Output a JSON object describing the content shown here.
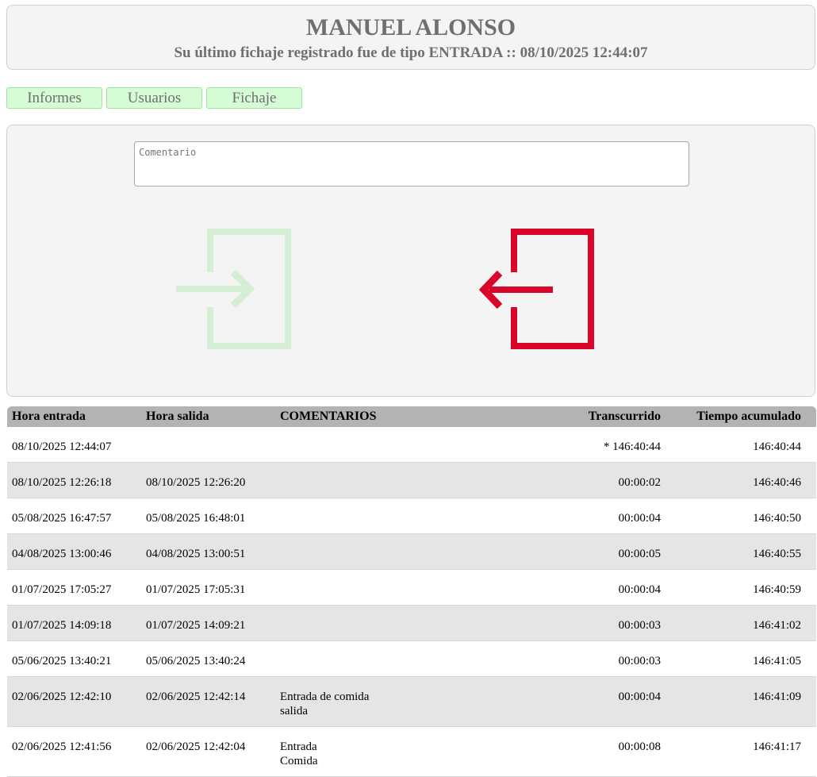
{
  "header": {
    "name": "MANUEL ALONSO",
    "last_entry": "Su último fichaje registrado fue de tipo ENTRADA :: 08/10/2025 12:44:07"
  },
  "nav": {
    "informes": "Informes",
    "usuarios": "Usuarios",
    "fichaje": "Fichaje"
  },
  "panel": {
    "comment_placeholder": "Comentario",
    "comment_value": "",
    "icon_in": "login-arrow-icon",
    "icon_out": "logout-arrow-icon",
    "colors": {
      "entry_disabled": "#d4efd4",
      "exit_active": "#d9062a"
    }
  },
  "table": {
    "headers": {
      "entrada": "Hora entrada",
      "salida": "Hora salida",
      "comentarios": "COMENTARIOS",
      "transcurrido": "Transcurrido",
      "acumulado": "Tiempo acumulado"
    },
    "rows": [
      {
        "entrada": "08/10/2025 12:44:07",
        "salida": "",
        "c1": "",
        "c2": "",
        "transcurrido": "* 146:40:44",
        "acumulado": "146:40:44"
      },
      {
        "entrada": "08/10/2025 12:26:18",
        "salida": "08/10/2025 12:26:20",
        "c1": "",
        "c2": "",
        "transcurrido": "00:00:02",
        "acumulado": "146:40:46"
      },
      {
        "entrada": "05/08/2025 16:47:57",
        "salida": "05/08/2025 16:48:01",
        "c1": "",
        "c2": "",
        "transcurrido": "00:00:04",
        "acumulado": "146:40:50"
      },
      {
        "entrada": "04/08/2025 13:00:46",
        "salida": "04/08/2025 13:00:51",
        "c1": "",
        "c2": "",
        "transcurrido": "00:00:05",
        "acumulado": "146:40:55"
      },
      {
        "entrada": "01/07/2025 17:05:27",
        "salida": "01/07/2025 17:05:31",
        "c1": "",
        "c2": "",
        "transcurrido": "00:00:04",
        "acumulado": "146:40:59"
      },
      {
        "entrada": "01/07/2025 14:09:18",
        "salida": "01/07/2025 14:09:21",
        "c1": "",
        "c2": "",
        "transcurrido": "00:00:03",
        "acumulado": "146:41:02"
      },
      {
        "entrada": "05/06/2025 13:40:21",
        "salida": "05/06/2025 13:40:24",
        "c1": "",
        "c2": "",
        "transcurrido": "00:00:03",
        "acumulado": "146:41:05"
      },
      {
        "entrada": "02/06/2025 12:42:10",
        "salida": "02/06/2025 12:42:14",
        "c1": "Entrada de comida",
        "c2": "salida",
        "transcurrido": "00:00:04",
        "acumulado": "146:41:09"
      },
      {
        "entrada": "02/06/2025 12:41:56",
        "salida": "02/06/2025 12:42:04",
        "c1": "Entrada",
        "c2": "Comida",
        "transcurrido": "00:00:08",
        "acumulado": "146:41:17"
      }
    ]
  }
}
